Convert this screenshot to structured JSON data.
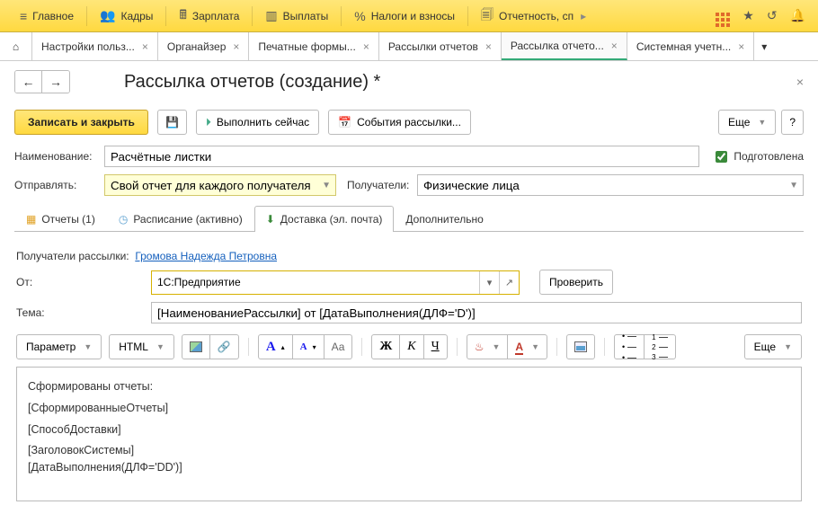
{
  "menu": {
    "items": [
      "Главное",
      "Кадры",
      "Зарплата",
      "Выплаты",
      "Налоги и взносы",
      "Отчетность, сп"
    ]
  },
  "tabs": {
    "items": [
      {
        "label": "Настройки польз..."
      },
      {
        "label": "Органайзер"
      },
      {
        "label": "Печатные формы..."
      },
      {
        "label": "Рассылки отчетов"
      },
      {
        "label": "Рассылка отчето...",
        "active": true
      },
      {
        "label": "Системная учетн..."
      }
    ]
  },
  "page": {
    "title": "Рассылка отчетов (создание) *"
  },
  "toolbar": {
    "save_close": "Записать и закрыть",
    "run_now": "Выполнить сейчас",
    "events": "События рассылки...",
    "more": "Еще"
  },
  "form": {
    "name_label": "Наименование:",
    "name_value": "Расчётные листки",
    "prepared_label": "Подготовлена",
    "send_label": "Отправлять:",
    "send_value": "Свой отчет для каждого получателя",
    "recipients_label": "Получатели:",
    "recipients_value": "Физические лица"
  },
  "subtabs": {
    "reports": "Отчеты (1)",
    "schedule": "Расписание (активно)",
    "delivery": "Доставка (эл. почта)",
    "additional": "Дополнительно"
  },
  "delivery": {
    "recipients_label": "Получатели рассылки:",
    "recipients_link": "Громова Надежда Петровна",
    "from_label": "От:",
    "from_value": "1С:Предприятие",
    "check_btn": "Проверить",
    "subject_label": "Тема:",
    "subject_value": "[НаименованиеРассылки] от [ДатаВыполнения(ДЛФ='D')]"
  },
  "editor": {
    "param_btn": "Параметр",
    "format_btn": "HTML",
    "more": "Еще",
    "font_plus": "А",
    "font_minus": "А",
    "bold": "Ж",
    "italic": "К",
    "under": "Ч"
  },
  "body_lines": [
    "Сформированы отчеты:",
    "[СформированныеОтчеты]",
    "[СпособДоставки]",
    "[ЗаголовокСистемы]",
    "[ДатаВыполнения(ДЛФ='DD')]"
  ]
}
